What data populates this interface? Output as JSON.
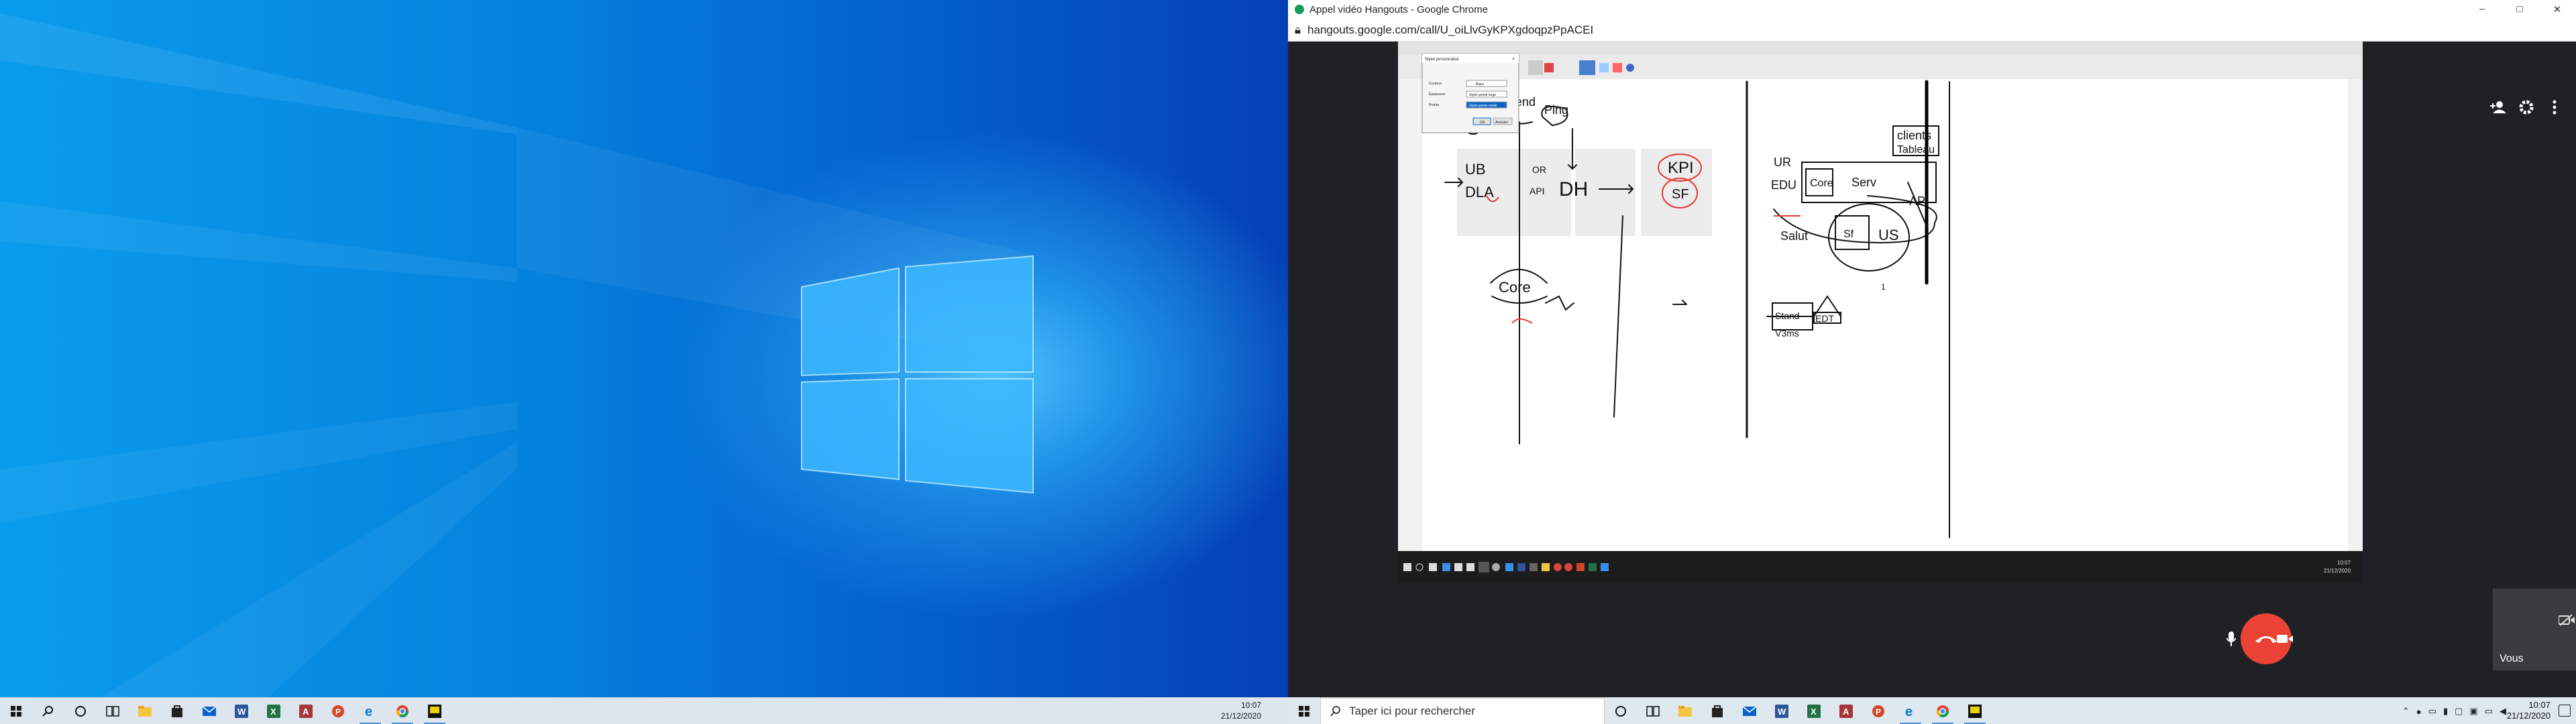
{
  "left_screen": {
    "taskbar": {
      "icons": [
        "windows-start-icon",
        "search-icon",
        "cortana-icon",
        "task-view-icon",
        "file-explorer-icon",
        "store-icon",
        "mail-icon",
        "word-icon",
        "excel-icon",
        "access-icon",
        "powerpoint-icon",
        "edge-icon",
        "chrome-icon",
        "custom-app-icon"
      ],
      "time": "10:07",
      "date": "21/12/2020"
    }
  },
  "chrome": {
    "title": "Appel vidéo Hangouts - Google Chrome",
    "url": "hangouts.google.com/call/U_oiLlvGyKPXgdoqpzPpACEI",
    "controls": {
      "minimize": "–",
      "maximize": "□",
      "close": "✕"
    }
  },
  "shared": {
    "dialog": {
      "title": "Stylet personnalisé",
      "fields": [
        {
          "label": "Couleur",
          "value": "Blanc"
        },
        {
          "label": "Épaisseur",
          "value": "Stylet pointe large"
        },
        {
          "label": "Pointe",
          "value": "Stylet pointe ronde"
        }
      ],
      "ok": "OK",
      "cancel": "Annuler"
    },
    "inner_clock": {
      "time": "10:07",
      "date": "21/12/2020"
    },
    "sketch": {
      "texts": [
        "S",
        "Talend",
        "Ping",
        "UB",
        "DLA",
        "OR",
        "API",
        "DH",
        "KPI",
        "SF",
        "Core",
        "clients",
        "Tableau",
        "UR",
        "EDU",
        "Core",
        "Serv",
        "API",
        "Salut",
        "Sf",
        "US",
        "Stand",
        "EDT",
        "V3ms",
        "1"
      ]
    }
  },
  "participant": {
    "label": "Vous"
  },
  "right_taskbar": {
    "search_placeholder": "Taper ici pour rechercher",
    "time": "10:07",
    "date": "21/12/2020",
    "icons": [
      "windows-start-icon",
      "cortana-icon",
      "task-view-icon",
      "file-explorer-icon",
      "store-icon",
      "mail-icon",
      "word-icon",
      "excel-icon",
      "access-icon",
      "powerpoint-icon",
      "edge-icon",
      "chrome-icon",
      "custom-app-icon"
    ]
  },
  "colors": {
    "call_end": "#ea4335",
    "ink": "#000000",
    "red_ink": "#e53935"
  }
}
